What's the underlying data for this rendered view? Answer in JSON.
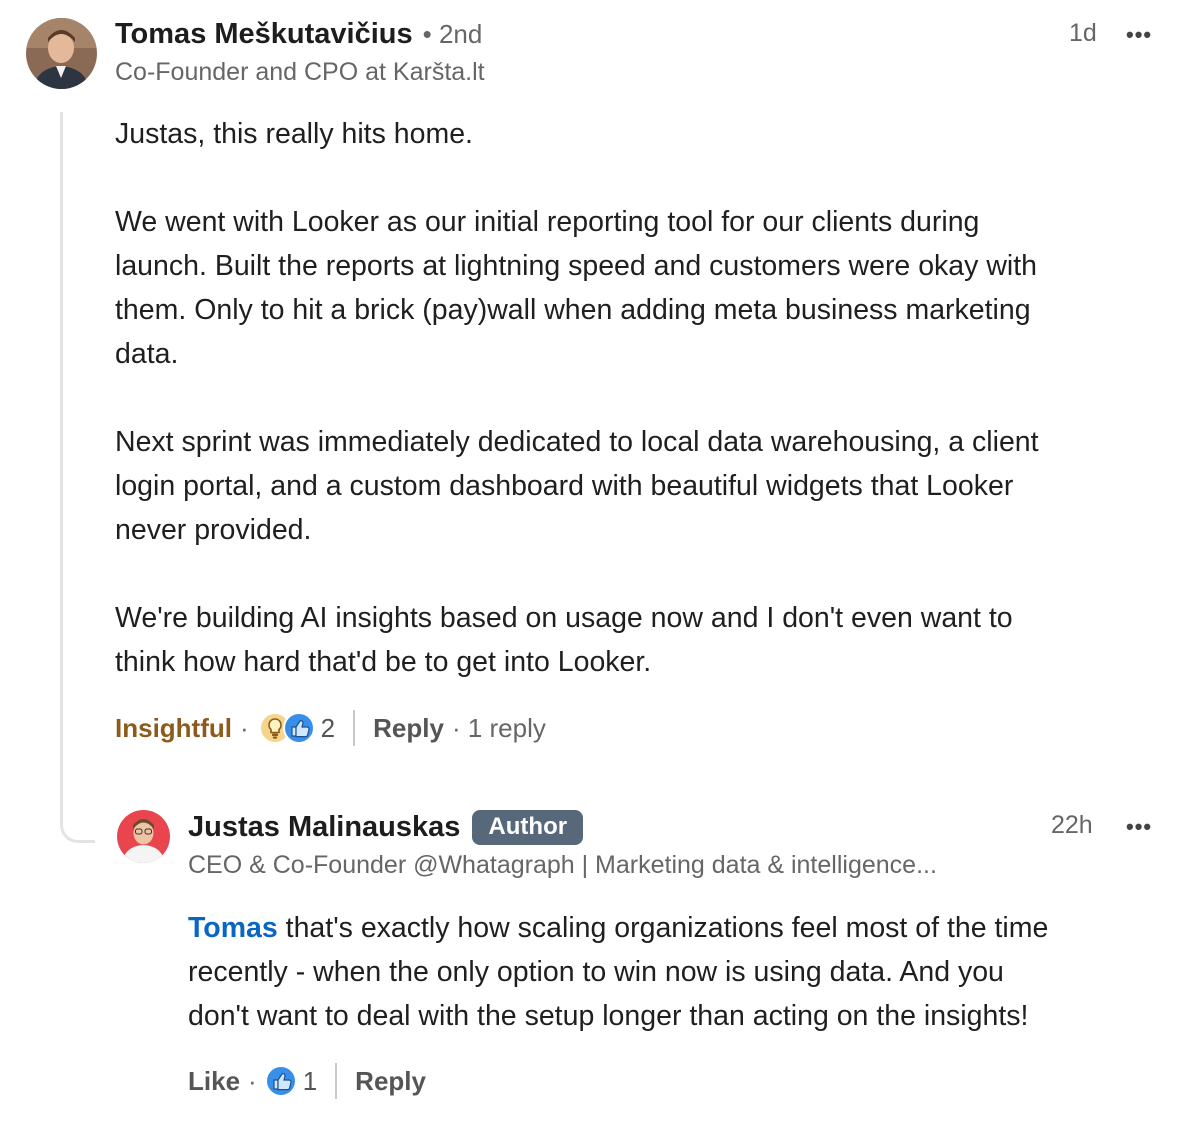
{
  "comment": {
    "author_name": "Tomas Meškutavičius",
    "degree": "• 2nd",
    "headline": "Co-Founder and CPO at Karšta.lt",
    "time": "1d",
    "more_label": "•••",
    "paragraphs": [
      [
        "Justas, this really hits home."
      ],
      [
        "We went with Looker as our initial reporting tool for our clients during",
        "launch. Built the reports at lightning speed and customers were okay with",
        "them. Only to hit a brick (pay)wall when adding meta business marketing",
        "data."
      ],
      [
        "Next sprint was immediately dedicated to local data warehousing, a client",
        "login portal, and a custom dashboard with beautiful widgets that Looker",
        "never provided."
      ],
      [
        "We're building AI insights based on usage now and I don't even want to",
        "think how hard that'd be to get into Looker."
      ]
    ],
    "reaction_label": "Insightful",
    "reaction_icons": [
      "lightbulb-icon",
      "thumbs-up-icon"
    ],
    "reaction_count": "2",
    "reply_label": "Reply",
    "replies_label": "· 1 reply",
    "dot": "·"
  },
  "reply": {
    "author_name": "Justas Malinauskas",
    "badge": "Author",
    "headline": "CEO & Co-Founder @Whatagraph | Marketing data & intelligence...",
    "time": "22h",
    "more_label": "•••",
    "mention": "Tomas",
    "lines": [
      " that's exactly how scaling organizations feel most of the time",
      "recently - when the only option to win now is using data. And you",
      "don't want to deal with the setup longer than acting on the insights!"
    ],
    "like_label": "Like",
    "reaction_icons": [
      "thumbs-up-icon"
    ],
    "reaction_count": "1",
    "reply_label": "Reply",
    "dot": "·"
  },
  "colors": {
    "insightful": "#8c5a1a",
    "mention": "#0a66c2",
    "badge_bg": "#56687a",
    "like_blue": "#378fe9"
  }
}
